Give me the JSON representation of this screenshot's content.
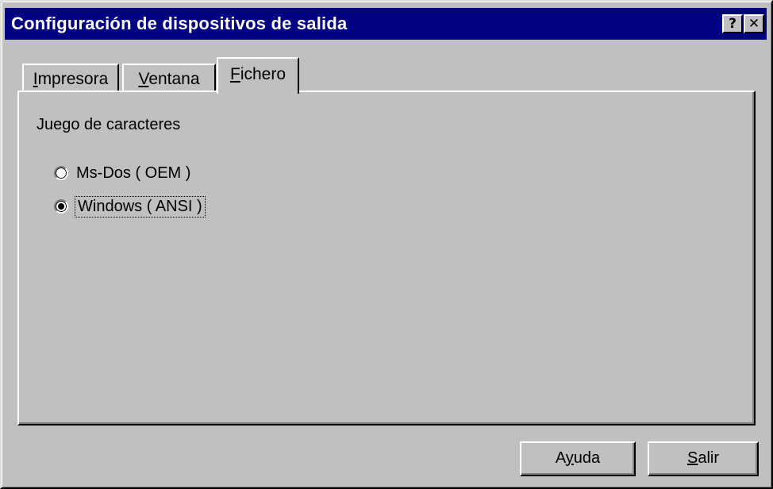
{
  "window": {
    "title": "Configuración de dispositivos de salida",
    "help_glyph": "?",
    "close_glyph": "✕"
  },
  "tabs": [
    {
      "pre": "",
      "accel": "I",
      "rest": "mpresora",
      "selected": false
    },
    {
      "pre": "",
      "accel": "V",
      "rest": "entana",
      "selected": false
    },
    {
      "pre": "",
      "accel": "F",
      "rest": "ichero",
      "selected": true
    }
  ],
  "panel": {
    "group_label": "Juego de caracteres",
    "options": [
      {
        "label": "Ms-Dos ( OEM )",
        "checked": false
      },
      {
        "label": "Windows ( ANSI )",
        "checked": true
      }
    ]
  },
  "buttons": {
    "ayuda": {
      "pre": "A",
      "accel": "y",
      "rest": "uda"
    },
    "salir": {
      "pre": "",
      "accel": "S",
      "rest": "alir"
    }
  },
  "colors": {
    "titlebar": "#000080",
    "face": "#c0c0c0"
  }
}
